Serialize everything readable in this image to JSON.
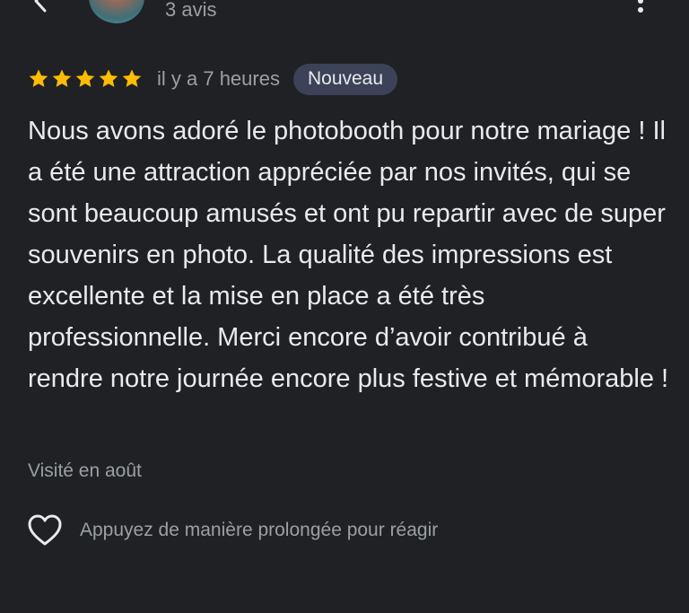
{
  "header": {
    "review_count": "3 avis",
    "back_icon": "chevron-left-icon",
    "more_icon": "more-vert-icon"
  },
  "review": {
    "rating": 5,
    "rating_max": 5,
    "time": "il y a 7 heures",
    "badge": "Nouveau",
    "text": "Nous avons adoré le photobooth pour notre mariage ! Il a été une attraction appréciée par nos invités, qui se sont beaucoup amusés et ont pu repartir avec de super souvenirs en photo. La qualité des impressions est excellente et la mise en place a été très professionnelle. Merci encore d’avoir contribué à rendre notre journée encore plus festive et mémorable !",
    "visit": "Visité en août"
  },
  "reaction": {
    "label": "Appuyez de manière prolongée pour réagir",
    "icon": "heart-outline-icon"
  },
  "colors": {
    "background": "#202124",
    "star": "#fbbc04",
    "badge_bg": "#3c4358",
    "secondary_text": "#9aa0a6",
    "primary_text": "#e8eaed"
  }
}
